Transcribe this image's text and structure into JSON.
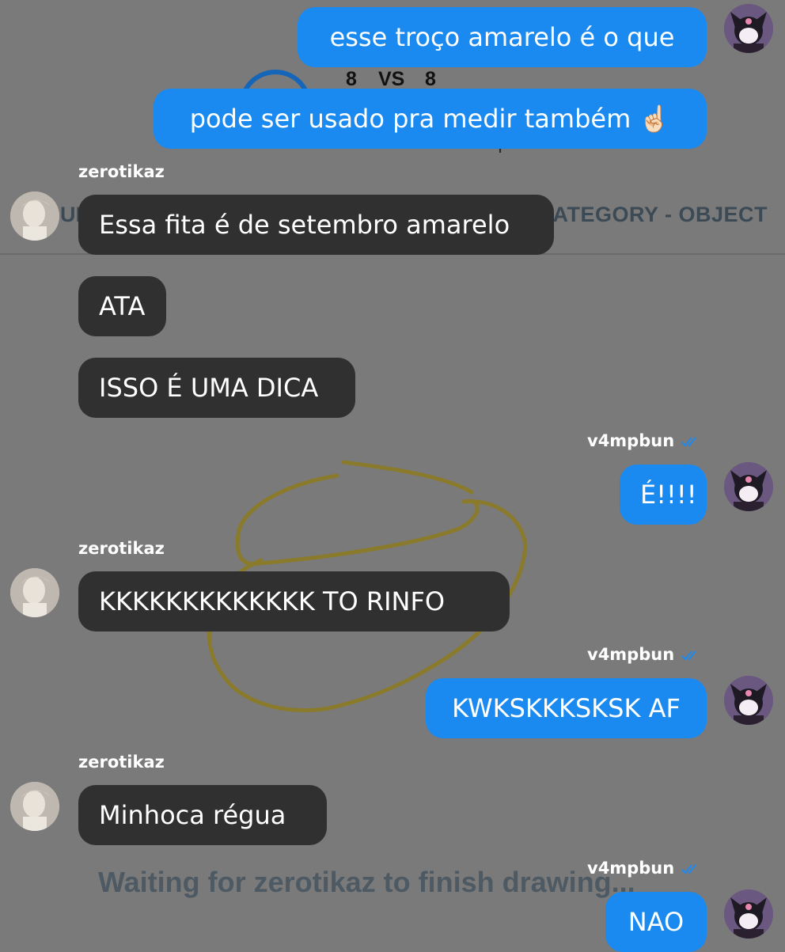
{
  "game": {
    "score_left": "8",
    "vs": "VS",
    "score_right": "8",
    "player_left": "zerotikaz",
    "player_right": "v4mpbun",
    "left_label": "UN",
    "category": "CATEGORY - OBJECT",
    "waiting": "Waiting for zerotikaz to finish drawing..."
  },
  "chat": {
    "m1": "esse troço amarelo é o que",
    "m2": "pode ser usado pra medir também ☝🏻",
    "u1": "zerotikaz",
    "m3": "Essa fita é de setembro amarelo",
    "m4": "ATA",
    "m5": "ISSO É UMA DICA",
    "u2": "v4mpbun",
    "m6": "É!!!!",
    "u3": "zerotikaz",
    "m7": "KKKKKKKKKKKKK TO RINFO",
    "u4": "v4mpbun",
    "m8": "KWKSKKKSKSK AF",
    "u5": "zerotikaz",
    "m9": "Minhoca régua",
    "u6": "v4mpbun",
    "m10": "NAO"
  },
  "colors": {
    "background": "#7a7a7a",
    "my_bubble": "#1b8af0",
    "their_bubble": "#303030",
    "drawing_stroke": "#8a7a2c",
    "read_ticks": "#1b8af0"
  },
  "icons": [
    "kuromi-avatar-icon",
    "profile-photo-avatar",
    "read-receipt-icon"
  ]
}
